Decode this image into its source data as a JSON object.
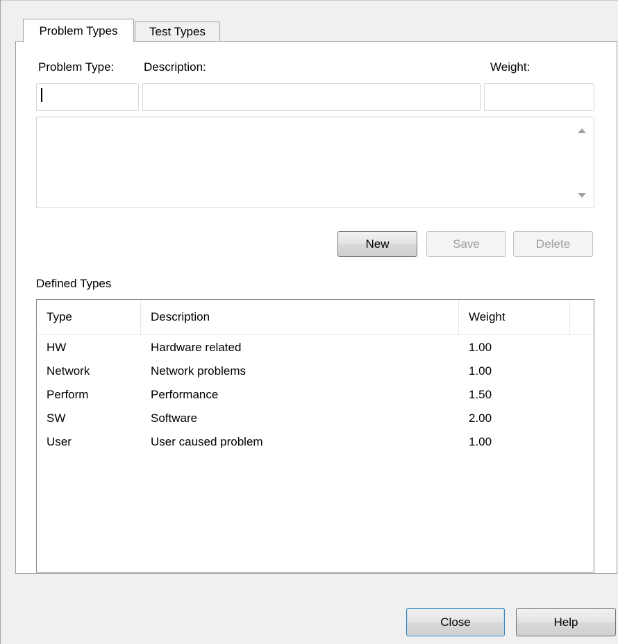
{
  "tabs": [
    {
      "label": "Problem Types",
      "active": true
    },
    {
      "label": "Test Types",
      "active": false
    }
  ],
  "form": {
    "problem_type_label": "Problem Type:",
    "description_label": "Description:",
    "weight_label": "Weight:",
    "problem_type_value": "",
    "description_value": "",
    "weight_value": ""
  },
  "buttons": {
    "new": "New",
    "save": "Save",
    "delete": "Delete",
    "close": "Close",
    "help": "Help"
  },
  "defined_types": {
    "label": "Defined Types",
    "columns": [
      "Type",
      "Description",
      "Weight"
    ],
    "rows": [
      [
        "HW",
        "Hardware related",
        "1.00"
      ],
      [
        "Network",
        "Network problems",
        "1.00"
      ],
      [
        "Perform",
        "Performance",
        "1.50"
      ],
      [
        "SW",
        "Software",
        "2.00"
      ],
      [
        "User",
        "User caused problem",
        "1.00"
      ]
    ]
  },
  "colors": {
    "panel_bg": "#ffffff",
    "window_bg": "#f0f0f0",
    "disabled_text": "#9d9d9d",
    "default_button_border": "#3c7fb1"
  }
}
